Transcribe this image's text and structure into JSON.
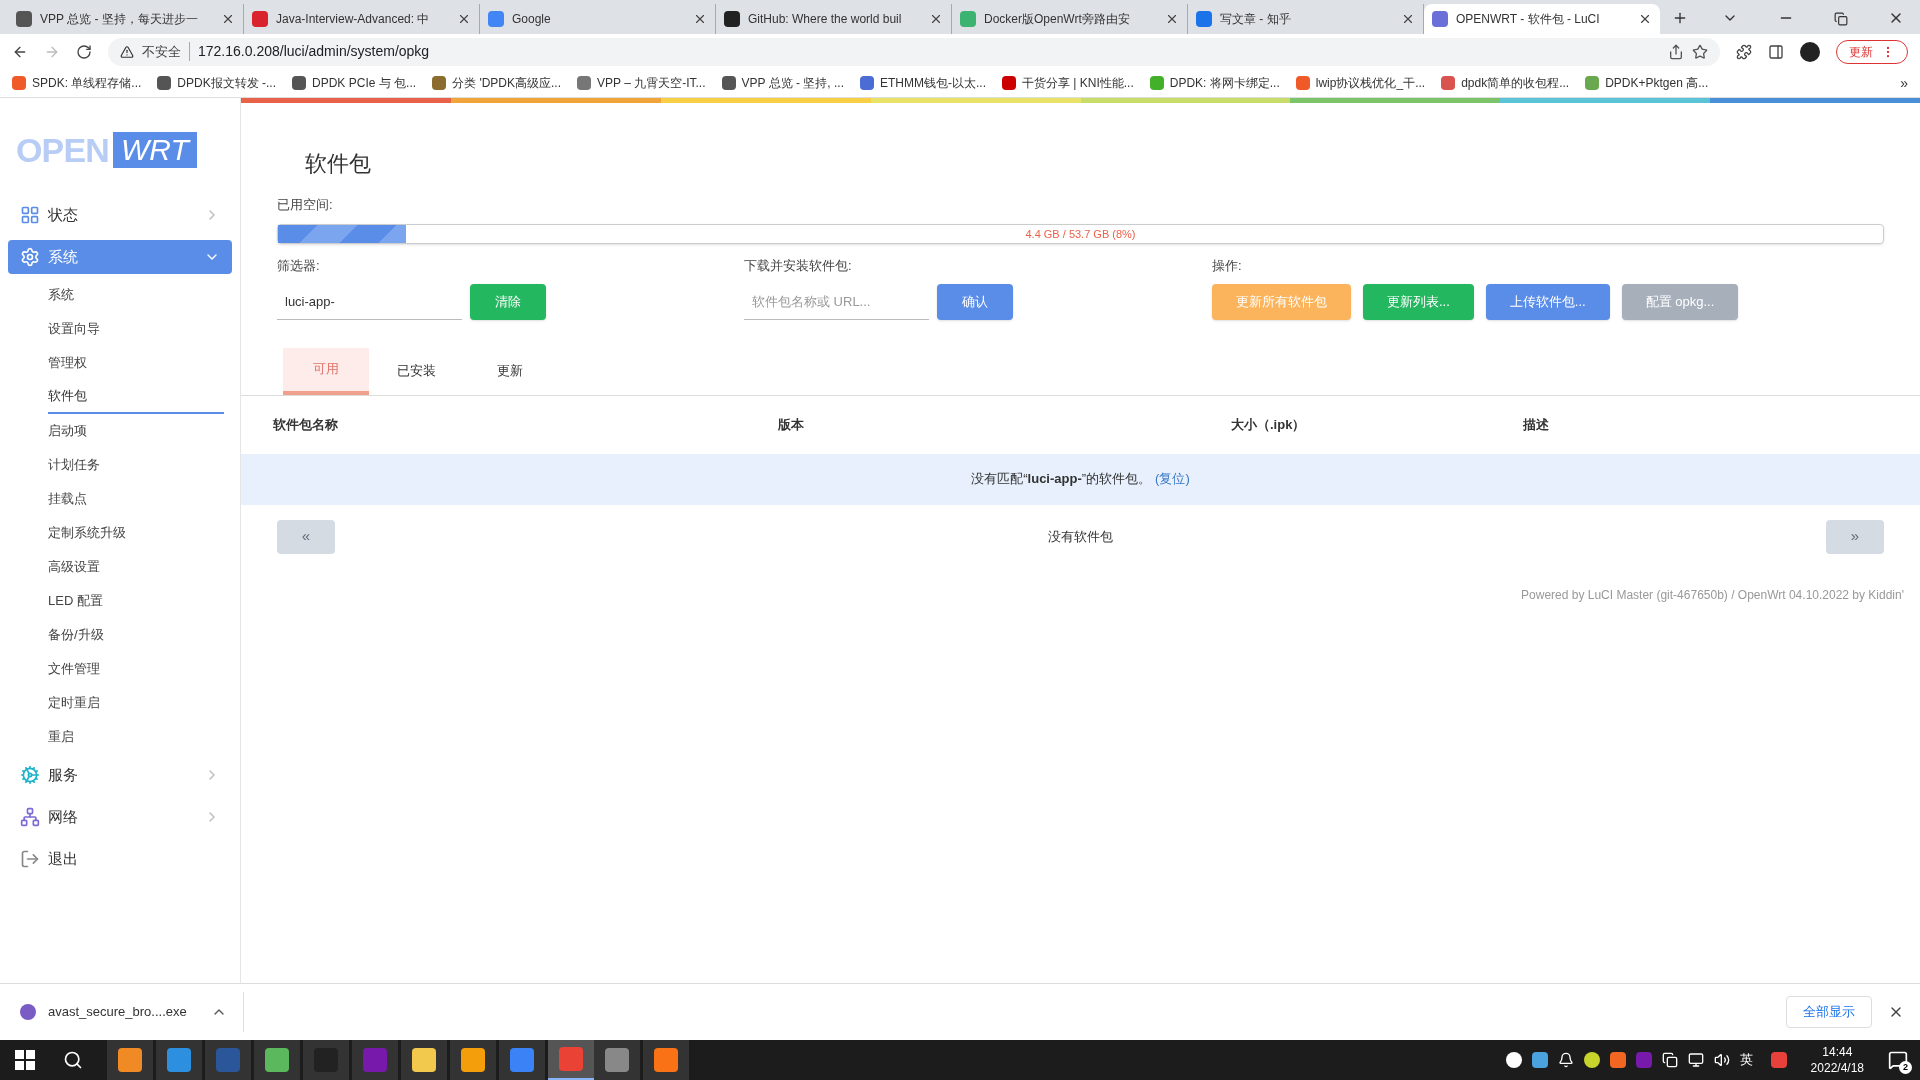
{
  "browser": {
    "tabs": [
      {
        "title": "VPP 总览 - 坚持，每天进步一",
        "selected": false
      },
      {
        "title": "Java-Interview-Advanced: 中",
        "selected": false
      },
      {
        "title": "Google",
        "selected": false
      },
      {
        "title": "GitHub: Where the world buil",
        "selected": false
      },
      {
        "title": "Docker版OpenWrt旁路由安",
        "selected": false
      },
      {
        "title": "写文章 - 知乎",
        "selected": false
      },
      {
        "title": "OPENWRT - 软件包 - LuCI",
        "selected": true
      }
    ],
    "address": {
      "security": "不安全",
      "url": "172.16.0.208/luci/admin/system/opkg"
    },
    "update_button": "更新",
    "bookmarks": [
      "SPDK: 单线程存储...",
      "DPDK报文转发 -...",
      "DPDK PCIe 与 包...",
      "分类 'DPDK高级应...",
      "VPP – 九霄天空-IT...",
      "VPP 总览 - 坚持, ...",
      "ETHMM钱包-以太...",
      "干货分享 | KNI性能...",
      "DPDK: 将网卡绑定...",
      "lwip协议栈优化_干...",
      "dpdk简单的收包程...",
      "DPDK+Pktgen 高..."
    ],
    "bookmarks_more": "»"
  },
  "sidebar": {
    "logo": [
      "OPEN",
      "WRT"
    ],
    "menu": [
      {
        "label": "状态",
        "expanded": false,
        "selected": false
      },
      {
        "label": "系统",
        "expanded": true,
        "selected": true,
        "children": [
          {
            "label": "系统",
            "selected": false
          },
          {
            "label": "设置向导",
            "selected": false
          },
          {
            "label": "管理权",
            "selected": false
          },
          {
            "label": "软件包",
            "selected": true
          },
          {
            "label": "启动项",
            "selected": false
          },
          {
            "label": "计划任务",
            "selected": false
          },
          {
            "label": "挂载点",
            "selected": false
          },
          {
            "label": "定制系统升级",
            "selected": false
          },
          {
            "label": "高级设置",
            "selected": false
          },
          {
            "label": "LED 配置",
            "selected": false
          },
          {
            "label": "备份/升级",
            "selected": false
          },
          {
            "label": "文件管理",
            "selected": false
          },
          {
            "label": "定时重启",
            "selected": false
          },
          {
            "label": "重启",
            "selected": false
          }
        ]
      },
      {
        "label": "服务",
        "expanded": false,
        "selected": false
      },
      {
        "label": "网络",
        "expanded": false,
        "selected": false
      },
      {
        "label": "退出",
        "expanded": false,
        "selected": false
      }
    ]
  },
  "main": {
    "title": "软件包",
    "usage": {
      "label": "已用空间:",
      "level": 0.08,
      "reading": "4.4 GB / 53.7 GB (8%)"
    },
    "filter": {
      "label": "筛选器:",
      "value": "luci-app-",
      "button": "清除"
    },
    "install": {
      "label": "下载并安装软件包:",
      "placeholder": "软件包名称或 URL...",
      "button": "确认"
    },
    "actions": {
      "label": "操作:",
      "buttons": [
        {
          "label": "更新所有软件包",
          "color": "#fbb45b"
        },
        {
          "label": "更新列表...",
          "color": "#23b75f"
        },
        {
          "label": "上传软件包...",
          "color": "#5a8de8"
        },
        {
          "label": "配置 opkg...",
          "color": "#a7afbb"
        }
      ]
    },
    "tabs": [
      {
        "label": "可用",
        "selected": true
      },
      {
        "label": "已安装",
        "selected": false
      },
      {
        "label": "更新",
        "selected": false
      }
    ],
    "table": {
      "columns": [
        "软件包名称",
        "版本",
        "大小（.ipk）",
        "描述"
      ],
      "empty_message": "没有匹配“**luci-app-**”的软件包。",
      "reset_link": "(复位)"
    },
    "pager": {
      "prev": "«",
      "status": "没有软件包",
      "next": "»"
    },
    "footer": "Powered by LuCI Master (git-467650b) / OpenWrt 04.10.2022 by Kiddin'"
  },
  "download": {
    "file": "avast_secure_bro....exe",
    "show_all": "全部显示"
  },
  "taskbar": {
    "apps": [
      {
        "selected": false
      },
      {
        "selected": false
      },
      {
        "selected": false
      },
      {
        "selected": false
      },
      {
        "selected": false
      },
      {
        "selected": false
      },
      {
        "selected": false
      },
      {
        "selected": false
      },
      {
        "selected": false
      },
      {
        "selected": true
      },
      {
        "selected": false
      },
      {
        "selected": false
      }
    ],
    "language": "英",
    "time": "14:44",
    "date": "2022/4/18",
    "notifications": "2"
  }
}
